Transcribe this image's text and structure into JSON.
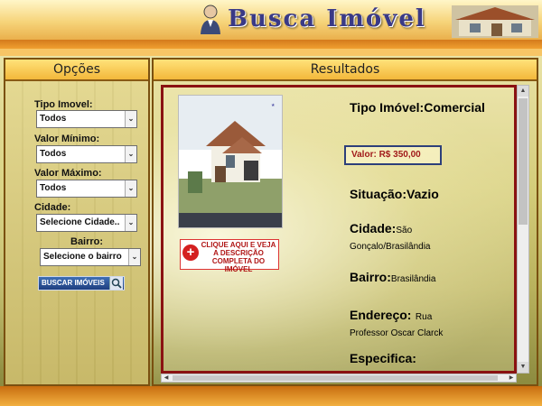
{
  "header": {
    "logo_text": "Busca Imóvel"
  },
  "left": {
    "title": "Opções",
    "filters": [
      {
        "label": "Tipo Imovel:",
        "value": "Todos"
      },
      {
        "label": "Valor Mínimo:",
        "value": "Todos"
      },
      {
        "label": "Valor Máximo:",
        "value": "Todos"
      },
      {
        "label": "Cidade:",
        "value": "Selecione Cidade.."
      },
      {
        "label": "Bairro:",
        "value": "Selecione o bairro"
      }
    ],
    "search_button": "BUSCAR IMÓVEIS"
  },
  "right": {
    "title": "Resultados",
    "cta_text": "CLIQUE AQUI E VEJA A DESCRIÇÃO COMPLETA DO IMÓVEL",
    "photo_caption": "",
    "fields": {
      "tipo_label": "Tipo Imóvel:",
      "tipo_value": "Comercial",
      "valor": "Valor: R$ 350,00",
      "situacao_label": "Situação:",
      "situacao_value": "Vazio",
      "cidade_label": "Cidade:",
      "cidade_value": "São Gonçalo/Brasilândia",
      "bairro_label": "Bairro:",
      "bairro_value": "Brasilândia",
      "endereco_label": "Endereço:",
      "endereco_value": "Rua Professor Oscar Clarck",
      "especifica_label": "Especifica:"
    }
  },
  "colors": {
    "accent": "#f3b83b",
    "border": "#8a1212",
    "price": "#a11a1a"
  }
}
